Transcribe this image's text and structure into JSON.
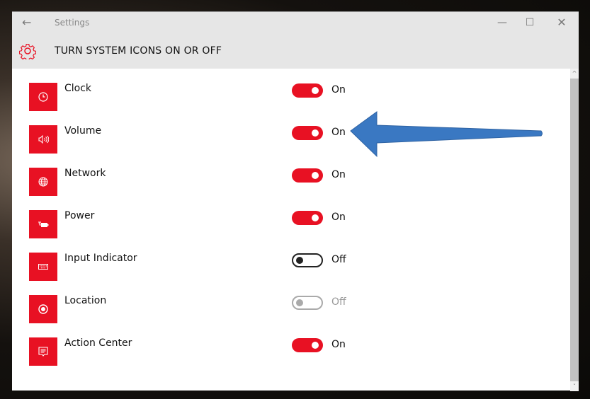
{
  "window": {
    "app_title": "Settings",
    "page_title": "TURN SYSTEM ICONS ON OR OFF"
  },
  "accent": "#e81123",
  "items": [
    {
      "label": "Clock",
      "icon": "clock-icon",
      "state": "On",
      "on": true,
      "disabled": false
    },
    {
      "label": "Volume",
      "icon": "volume-icon",
      "state": "On",
      "on": true,
      "disabled": false
    },
    {
      "label": "Network",
      "icon": "globe-icon",
      "state": "On",
      "on": true,
      "disabled": false
    },
    {
      "label": "Power",
      "icon": "battery-icon",
      "state": "On",
      "on": true,
      "disabled": false
    },
    {
      "label": "Input Indicator",
      "icon": "keyboard-icon",
      "state": "Off",
      "on": false,
      "disabled": false
    },
    {
      "label": "Location",
      "icon": "location-icon",
      "state": "Off",
      "on": false,
      "disabled": true
    },
    {
      "label": "Action Center",
      "icon": "action-center-icon",
      "state": "On",
      "on": true,
      "disabled": false
    }
  ]
}
